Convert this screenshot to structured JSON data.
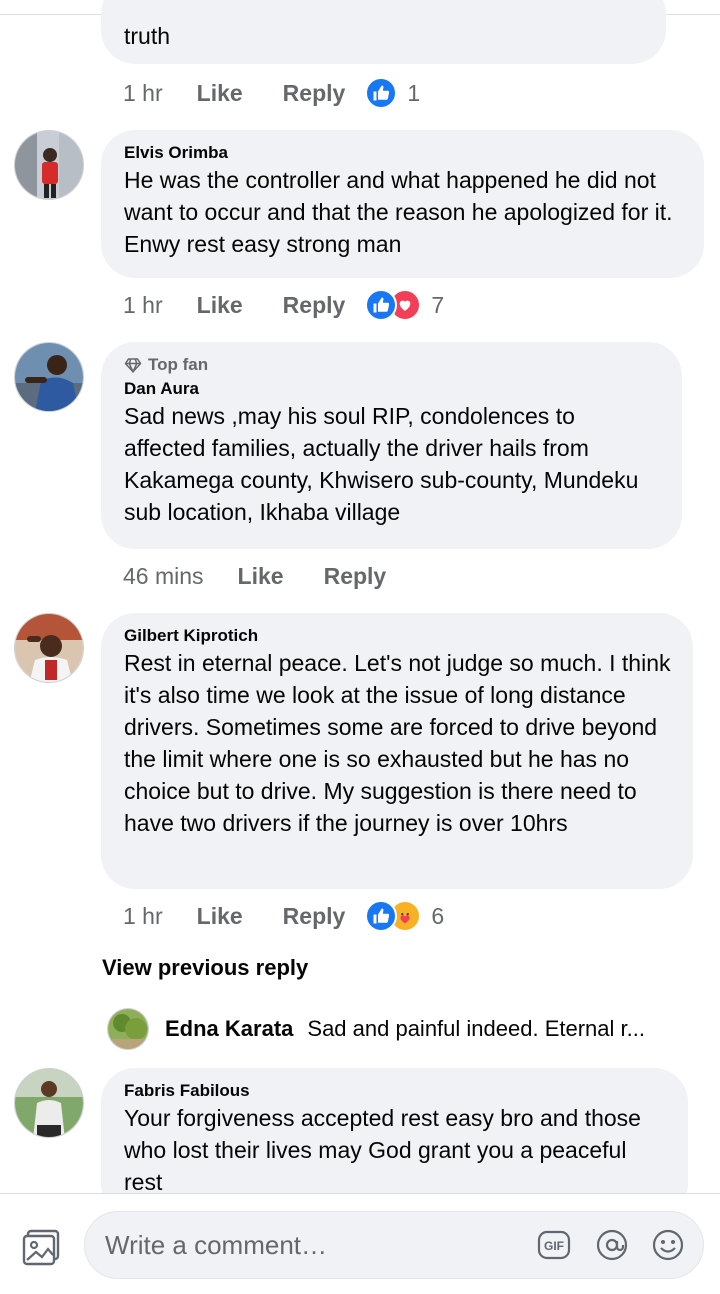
{
  "comments": [
    {
      "text": "truth",
      "time": "1 hr",
      "like_label": "Like",
      "reply_label": "Reply",
      "reaction_count": "1",
      "reactions": [
        "like-icon"
      ]
    },
    {
      "name": "Elvis Orimba",
      "text": "He was the controller and what happened he did not want to occur and that the reason he apologized for it. Enwy rest easy strong man",
      "time": "1 hr",
      "like_label": "Like",
      "reply_label": "Reply",
      "reaction_count": "7",
      "reactions": [
        "like-icon",
        "love-icon"
      ]
    },
    {
      "badge": "Top fan",
      "name": "Dan Aura",
      "text": "Sad news ,may his soul RIP, condolences to affected families, actually the driver hails from Kakamega county, Khwisero sub-county, Mundeku sub location, Ikhaba village",
      "time": "46 mins",
      "like_label": "Like",
      "reply_label": "Reply"
    },
    {
      "name": "Gilbert Kiprotich",
      "text": "Rest in eternal peace. Let's not judge so much. I think it's also time we look at the issue of long distance drivers. Sometimes some are forced to drive beyond the limit where one is so exhausted but he has no choice but to drive. My suggestion is there need to have two drivers if the journey is over 10hrs",
      "time": "1 hr",
      "like_label": "Like",
      "reply_label": "Reply",
      "reaction_count": "6",
      "reactions": [
        "like-icon",
        "care-icon"
      ]
    },
    {
      "name": "Fabris Fabilous",
      "text": "Your forgiveness accepted rest easy bro and those who lost their lives may God grant you a peaceful rest"
    }
  ],
  "view_previous_reply": "View previous reply",
  "reply_preview": {
    "name": "Edna Karata",
    "text": "Sad and painful indeed. Eternal r..."
  },
  "composer": {
    "placeholder": "Write a comment…",
    "gif_label": "GIF"
  },
  "colors": {
    "bubble": "#f0f2f5",
    "like_blue": "#1877f2",
    "love_red": "#f33e58",
    "secondary_text": "#65676b"
  }
}
